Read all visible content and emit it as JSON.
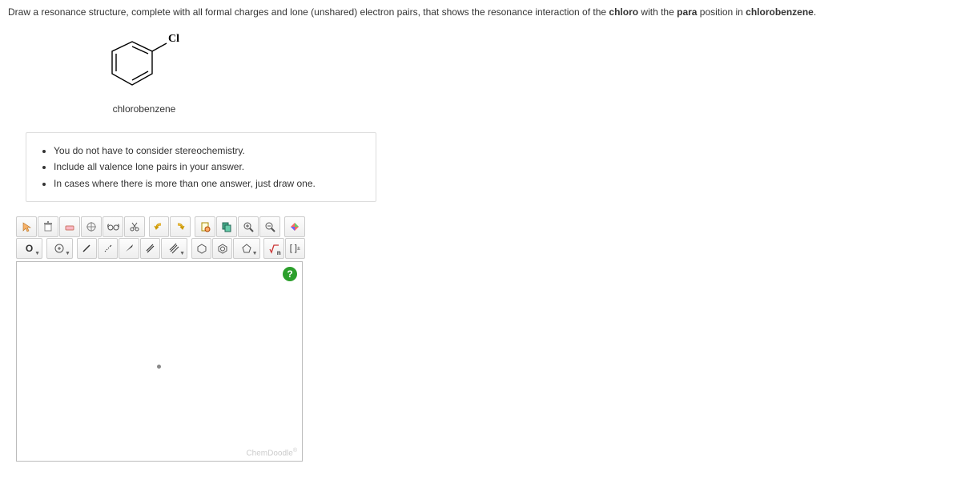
{
  "question": {
    "pre": "Draw a resonance structure, complete with all formal charges and lone (unshared) electron pairs, that shows the resonance interaction of the ",
    "bold1": "chloro",
    "mid": " with the ",
    "bold2": "para",
    "post": " position in ",
    "bold3": "chlorobenzene",
    "end": "."
  },
  "structure": {
    "atom_label": "Cl",
    "name": "chlorobenzene"
  },
  "instructions": {
    "items": [
      "You do not have to consider stereochemistry.",
      "Include all valence lone pairs in your answer.",
      "In cases where there is more than one answer, just draw one."
    ]
  },
  "tools": {
    "label_O": "O",
    "help": "?",
    "brand": "ChemDoodle",
    "brand_sup": "®",
    "sqrt_n": "n",
    "brackets": "[ ]",
    "pm": "±"
  }
}
